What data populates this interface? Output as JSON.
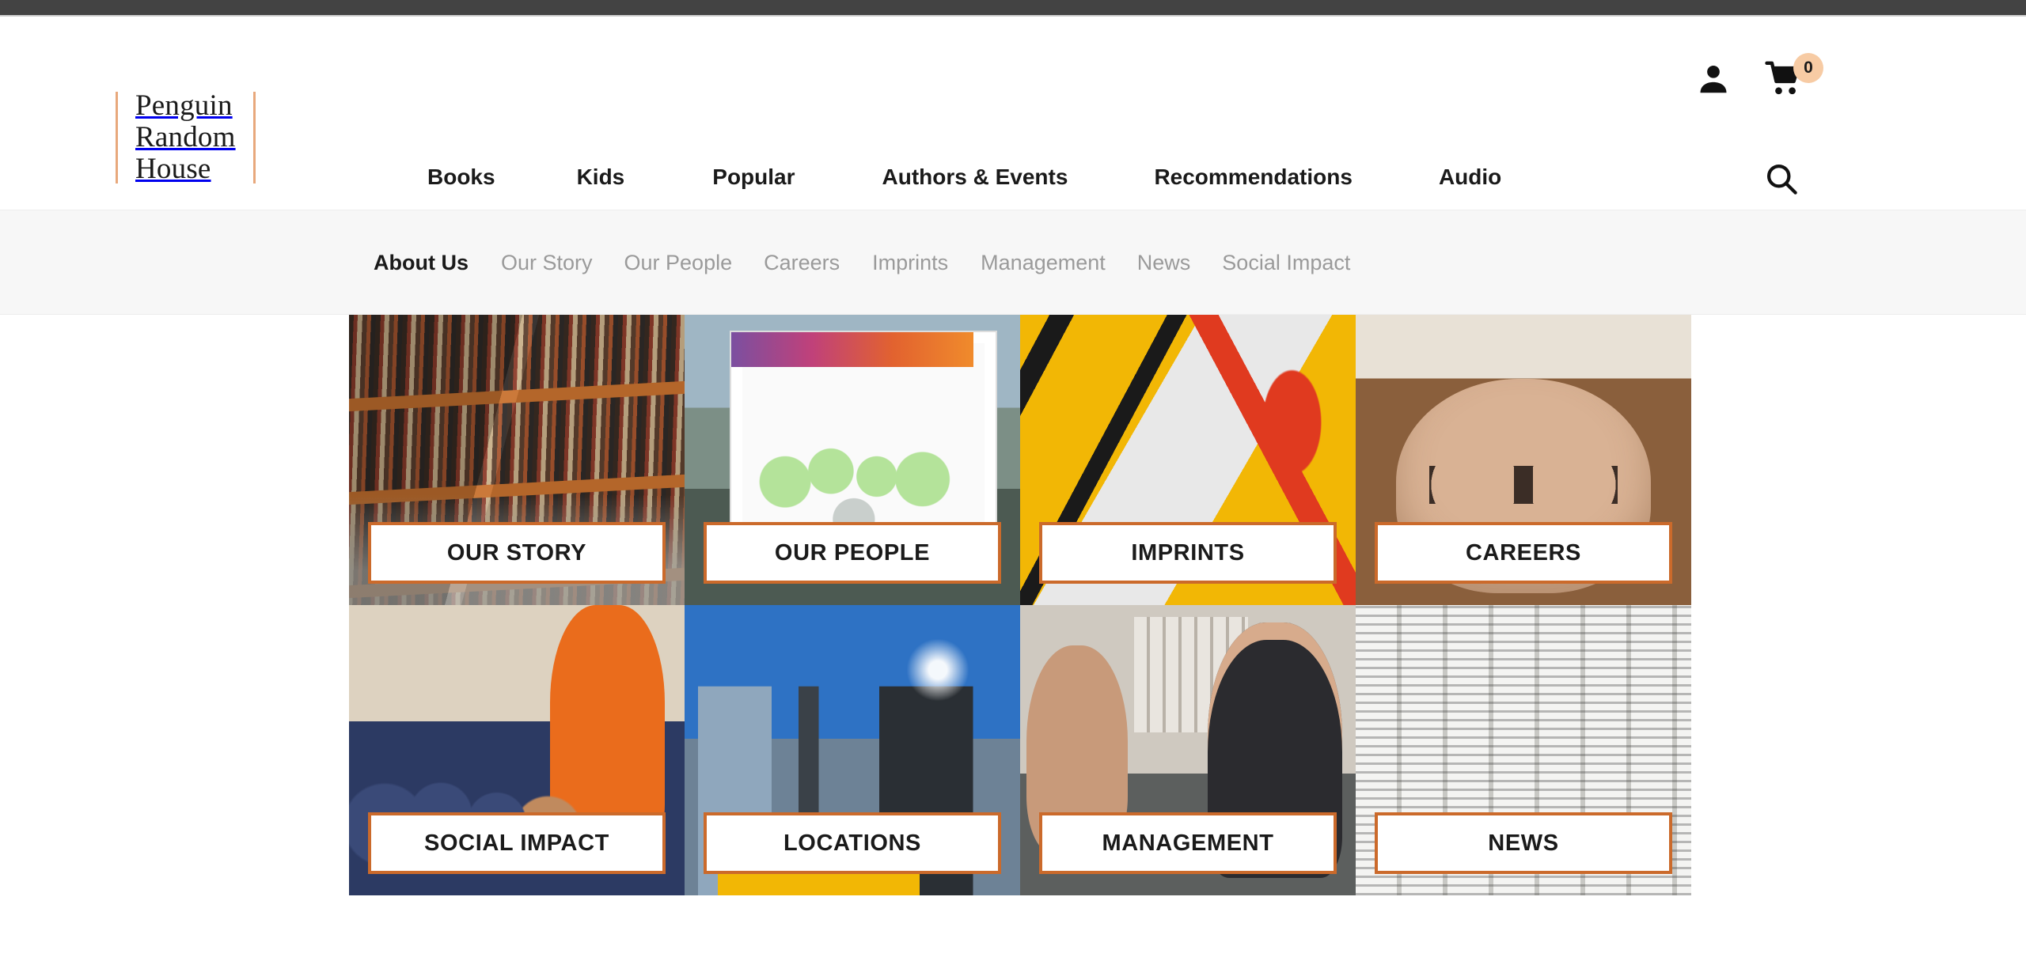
{
  "top_bar": {
    "present": true,
    "color": "#434343"
  },
  "header": {
    "logo": {
      "line1": "Penguin",
      "line2": "Random",
      "line3": "House",
      "rule_color": "#e8a87c"
    },
    "primary_nav": [
      {
        "label": "Books"
      },
      {
        "label": "Kids"
      },
      {
        "label": "Popular"
      },
      {
        "label": "Authors & Events"
      },
      {
        "label": "Recommendations"
      },
      {
        "label": "Audio"
      }
    ],
    "icons": {
      "account": "person-icon",
      "cart": "shopping-cart-icon",
      "search": "search-icon"
    },
    "cart_count": "0",
    "cart_badge_color": "#f7cba4"
  },
  "sub_nav": {
    "background": "#f7f7f7",
    "items": [
      {
        "label": "About Us",
        "active": true
      },
      {
        "label": "Our Story",
        "active": false
      },
      {
        "label": "Our People",
        "active": false
      },
      {
        "label": "Careers",
        "active": false
      },
      {
        "label": "Imprints",
        "active": false
      },
      {
        "label": "Management",
        "active": false
      },
      {
        "label": "News",
        "active": false
      },
      {
        "label": "Social Impact",
        "active": false
      }
    ]
  },
  "tile_grid": {
    "accent_color": "#cb6a2b",
    "tiles": [
      {
        "label": "OUR STORY",
        "image": "bookshelf-aisle-photo"
      },
      {
        "label": "OUR PEOPLE",
        "image": "company-week-group-photo"
      },
      {
        "label": "IMPRINTS",
        "image": "yellow-signage-photo"
      },
      {
        "label": "CAREERS",
        "image": "man-holding-book-photo"
      },
      {
        "label": "SOCIAL IMPACT",
        "image": "classroom-students-photo"
      },
      {
        "label": "LOCATIONS",
        "image": "city-skyscrapers-photo"
      },
      {
        "label": "MANAGEMENT",
        "image": "office-colleagues-photo"
      },
      {
        "label": "NEWS",
        "image": "newspapers-stack-photo"
      }
    ]
  }
}
